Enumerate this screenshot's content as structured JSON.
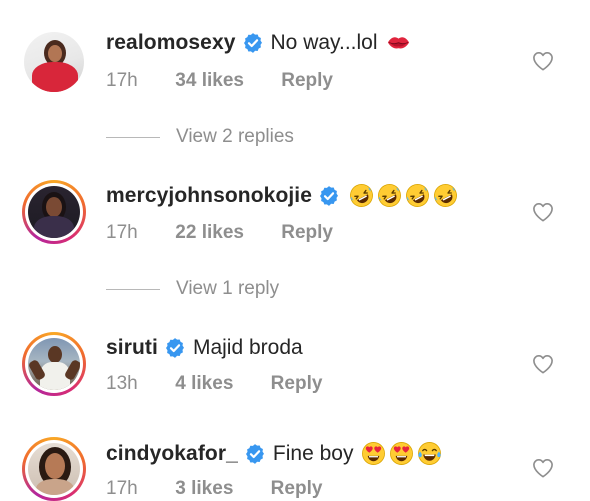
{
  "comments": [
    {
      "username": "realomosexy",
      "text": "No way...lol",
      "emojis": [
        "kiss-mark"
      ],
      "time": "17h",
      "likes": "34 likes",
      "reply": "Reply",
      "avatar_ring": false
    },
    {
      "username": "mercyjohnsonokojie",
      "text": "",
      "emojis": [
        "rolling-laughing",
        "rolling-laughing",
        "rolling-laughing",
        "rolling-laughing"
      ],
      "time": "17h",
      "likes": "22 likes",
      "reply": "Reply",
      "avatar_ring": true
    },
    {
      "username": "siruti",
      "text": "Majid broda",
      "emojis": [],
      "time": "13h",
      "likes": "4 likes",
      "reply": "Reply",
      "avatar_ring": true
    },
    {
      "username": "cindyokafor_",
      "text": "Fine boy",
      "emojis": [
        "heart-eyes",
        "heart-eyes",
        "tears-of-joy"
      ],
      "time": "17h",
      "likes": "3 likes",
      "reply": "Reply",
      "avatar_ring": true
    }
  ],
  "view_replies": [
    {
      "label": "View 2 replies"
    },
    {
      "label": "View 1 reply"
    }
  ],
  "colors": {
    "verified_badge": "#3897f0",
    "muted_text": "#8e8e8e",
    "primary_text": "#262626",
    "ring_gradient": [
      "#f9a826",
      "#d92d72",
      "#b3269c"
    ]
  }
}
